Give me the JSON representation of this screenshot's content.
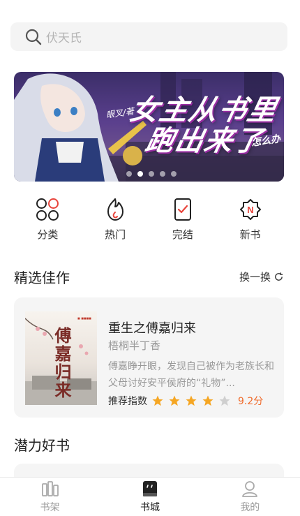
{
  "search": {
    "placeholder": "伏天氏"
  },
  "banner": {
    "title_line1": "女主从书里",
    "title_line2": "跑出来了",
    "tag": "眼叉/著",
    "tag2": "怎么办",
    "slide_count": 5,
    "active_slide": 1
  },
  "categories": [
    {
      "label": "分类",
      "icon": "category-icon"
    },
    {
      "label": "热门",
      "icon": "fire-icon"
    },
    {
      "label": "完结",
      "icon": "finished-icon"
    },
    {
      "label": "新书",
      "icon": "new-book-icon"
    }
  ],
  "featured": {
    "title": "精选佳作",
    "refresh_label": "换一换",
    "book": {
      "cover_text": "傅嘉归来",
      "title": "重生之傅嘉归来",
      "author": "梧桐半丁香",
      "description": "傅嘉睁开眼，发现自己被作为老族长和父母讨好安平侯府的“礼物”...",
      "rating_label": "推荐指数",
      "stars_filled": 4,
      "stars_total": 5,
      "score": "9.2分"
    }
  },
  "potential": {
    "title": "潜力好书"
  },
  "tabbar": {
    "items": [
      {
        "label": "书架",
        "icon": "bookshelf-icon"
      },
      {
        "label": "书城",
        "icon": "bookstore-icon"
      },
      {
        "label": "我的",
        "icon": "profile-icon"
      }
    ],
    "active_index": 1
  },
  "colors": {
    "accent_red": "#e8453c",
    "star": "#f5a623",
    "score": "#f06a2a"
  }
}
